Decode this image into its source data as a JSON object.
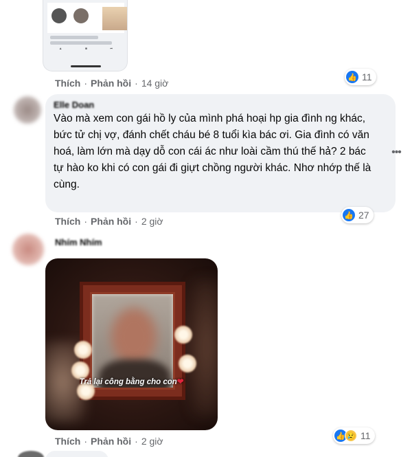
{
  "comment1": {
    "actions": {
      "like": "Thích",
      "reply": "Phản hồi",
      "time": "14 giờ"
    },
    "reactions": {
      "like_count": "11"
    }
  },
  "comment2": {
    "author": "Elle Doan",
    "text": "Vào mà xem con gái hồ ly của mình phá hoại hp gia đình ng khác, bức tử chị vợ, đánh chết cháu bé 8 tuổi kìa bác ơi. Gia đình có văn hoá, làm lớn mà dạy dỗ con cái ác như loài cầm thú thế hả? 2 bác tự hào ko khi có con gái đi giựt chồng người khác. Nhơ nhớp thế là cùng.",
    "actions": {
      "like": "Thích",
      "reply": "Phản hồi",
      "time": "2 giờ"
    },
    "reactions": {
      "like_count": "27"
    }
  },
  "comment3": {
    "author": "Nhím Nhím",
    "image_caption": "Trả lại công bằng cho con",
    "actions": {
      "like": "Thích",
      "reply": "Phản hồi",
      "time": "2 giờ"
    },
    "reactions": {
      "count": "11"
    }
  },
  "colors": {
    "accent": "#1877f2",
    "bubble": "#f0f2f5",
    "muted_text": "#65676b"
  }
}
